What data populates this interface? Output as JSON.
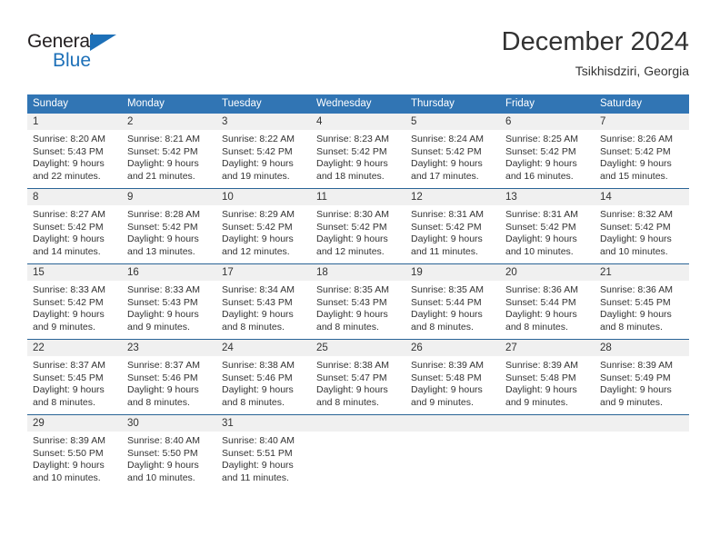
{
  "logo": {
    "word_top": "General",
    "word_bottom": "Blue",
    "triangle_color": "#1d70b8",
    "text_color": "#231f20"
  },
  "header": {
    "title": "December 2024",
    "subtitle": "Tsikhisdziri, Georgia"
  },
  "theme": {
    "header_bg": "#3175b4",
    "row_divider": "#2a6496",
    "daynum_bg": "#f0f0f0",
    "text": "#333333"
  },
  "calendar": {
    "weekday_headers": [
      "Sunday",
      "Monday",
      "Tuesday",
      "Wednesday",
      "Thursday",
      "Friday",
      "Saturday"
    ],
    "weeks": [
      [
        {
          "day": "1",
          "sunrise": "Sunrise: 8:20 AM",
          "sunset": "Sunset: 5:43 PM",
          "daylight1": "Daylight: 9 hours",
          "daylight2": "and 22 minutes."
        },
        {
          "day": "2",
          "sunrise": "Sunrise: 8:21 AM",
          "sunset": "Sunset: 5:42 PM",
          "daylight1": "Daylight: 9 hours",
          "daylight2": "and 21 minutes."
        },
        {
          "day": "3",
          "sunrise": "Sunrise: 8:22 AM",
          "sunset": "Sunset: 5:42 PM",
          "daylight1": "Daylight: 9 hours",
          "daylight2": "and 19 minutes."
        },
        {
          "day": "4",
          "sunrise": "Sunrise: 8:23 AM",
          "sunset": "Sunset: 5:42 PM",
          "daylight1": "Daylight: 9 hours",
          "daylight2": "and 18 minutes."
        },
        {
          "day": "5",
          "sunrise": "Sunrise: 8:24 AM",
          "sunset": "Sunset: 5:42 PM",
          "daylight1": "Daylight: 9 hours",
          "daylight2": "and 17 minutes."
        },
        {
          "day": "6",
          "sunrise": "Sunrise: 8:25 AM",
          "sunset": "Sunset: 5:42 PM",
          "daylight1": "Daylight: 9 hours",
          "daylight2": "and 16 minutes."
        },
        {
          "day": "7",
          "sunrise": "Sunrise: 8:26 AM",
          "sunset": "Sunset: 5:42 PM",
          "daylight1": "Daylight: 9 hours",
          "daylight2": "and 15 minutes."
        }
      ],
      [
        {
          "day": "8",
          "sunrise": "Sunrise: 8:27 AM",
          "sunset": "Sunset: 5:42 PM",
          "daylight1": "Daylight: 9 hours",
          "daylight2": "and 14 minutes."
        },
        {
          "day": "9",
          "sunrise": "Sunrise: 8:28 AM",
          "sunset": "Sunset: 5:42 PM",
          "daylight1": "Daylight: 9 hours",
          "daylight2": "and 13 minutes."
        },
        {
          "day": "10",
          "sunrise": "Sunrise: 8:29 AM",
          "sunset": "Sunset: 5:42 PM",
          "daylight1": "Daylight: 9 hours",
          "daylight2": "and 12 minutes."
        },
        {
          "day": "11",
          "sunrise": "Sunrise: 8:30 AM",
          "sunset": "Sunset: 5:42 PM",
          "daylight1": "Daylight: 9 hours",
          "daylight2": "and 12 minutes."
        },
        {
          "day": "12",
          "sunrise": "Sunrise: 8:31 AM",
          "sunset": "Sunset: 5:42 PM",
          "daylight1": "Daylight: 9 hours",
          "daylight2": "and 11 minutes."
        },
        {
          "day": "13",
          "sunrise": "Sunrise: 8:31 AM",
          "sunset": "Sunset: 5:42 PM",
          "daylight1": "Daylight: 9 hours",
          "daylight2": "and 10 minutes."
        },
        {
          "day": "14",
          "sunrise": "Sunrise: 8:32 AM",
          "sunset": "Sunset: 5:42 PM",
          "daylight1": "Daylight: 9 hours",
          "daylight2": "and 10 minutes."
        }
      ],
      [
        {
          "day": "15",
          "sunrise": "Sunrise: 8:33 AM",
          "sunset": "Sunset: 5:42 PM",
          "daylight1": "Daylight: 9 hours",
          "daylight2": "and 9 minutes."
        },
        {
          "day": "16",
          "sunrise": "Sunrise: 8:33 AM",
          "sunset": "Sunset: 5:43 PM",
          "daylight1": "Daylight: 9 hours",
          "daylight2": "and 9 minutes."
        },
        {
          "day": "17",
          "sunrise": "Sunrise: 8:34 AM",
          "sunset": "Sunset: 5:43 PM",
          "daylight1": "Daylight: 9 hours",
          "daylight2": "and 8 minutes."
        },
        {
          "day": "18",
          "sunrise": "Sunrise: 8:35 AM",
          "sunset": "Sunset: 5:43 PM",
          "daylight1": "Daylight: 9 hours",
          "daylight2": "and 8 minutes."
        },
        {
          "day": "19",
          "sunrise": "Sunrise: 8:35 AM",
          "sunset": "Sunset: 5:44 PM",
          "daylight1": "Daylight: 9 hours",
          "daylight2": "and 8 minutes."
        },
        {
          "day": "20",
          "sunrise": "Sunrise: 8:36 AM",
          "sunset": "Sunset: 5:44 PM",
          "daylight1": "Daylight: 9 hours",
          "daylight2": "and 8 minutes."
        },
        {
          "day": "21",
          "sunrise": "Sunrise: 8:36 AM",
          "sunset": "Sunset: 5:45 PM",
          "daylight1": "Daylight: 9 hours",
          "daylight2": "and 8 minutes."
        }
      ],
      [
        {
          "day": "22",
          "sunrise": "Sunrise: 8:37 AM",
          "sunset": "Sunset: 5:45 PM",
          "daylight1": "Daylight: 9 hours",
          "daylight2": "and 8 minutes."
        },
        {
          "day": "23",
          "sunrise": "Sunrise: 8:37 AM",
          "sunset": "Sunset: 5:46 PM",
          "daylight1": "Daylight: 9 hours",
          "daylight2": "and 8 minutes."
        },
        {
          "day": "24",
          "sunrise": "Sunrise: 8:38 AM",
          "sunset": "Sunset: 5:46 PM",
          "daylight1": "Daylight: 9 hours",
          "daylight2": "and 8 minutes."
        },
        {
          "day": "25",
          "sunrise": "Sunrise: 8:38 AM",
          "sunset": "Sunset: 5:47 PM",
          "daylight1": "Daylight: 9 hours",
          "daylight2": "and 8 minutes."
        },
        {
          "day": "26",
          "sunrise": "Sunrise: 8:39 AM",
          "sunset": "Sunset: 5:48 PM",
          "daylight1": "Daylight: 9 hours",
          "daylight2": "and 9 minutes."
        },
        {
          "day": "27",
          "sunrise": "Sunrise: 8:39 AM",
          "sunset": "Sunset: 5:48 PM",
          "daylight1": "Daylight: 9 hours",
          "daylight2": "and 9 minutes."
        },
        {
          "day": "28",
          "sunrise": "Sunrise: 8:39 AM",
          "sunset": "Sunset: 5:49 PM",
          "daylight1": "Daylight: 9 hours",
          "daylight2": "and 9 minutes."
        }
      ],
      [
        {
          "day": "29",
          "sunrise": "Sunrise: 8:39 AM",
          "sunset": "Sunset: 5:50 PM",
          "daylight1": "Daylight: 9 hours",
          "daylight2": "and 10 minutes."
        },
        {
          "day": "30",
          "sunrise": "Sunrise: 8:40 AM",
          "sunset": "Sunset: 5:50 PM",
          "daylight1": "Daylight: 9 hours",
          "daylight2": "and 10 minutes."
        },
        {
          "day": "31",
          "sunrise": "Sunrise: 8:40 AM",
          "sunset": "Sunset: 5:51 PM",
          "daylight1": "Daylight: 9 hours",
          "daylight2": "and 11 minutes."
        },
        {
          "day": "",
          "sunrise": "",
          "sunset": "",
          "daylight1": "",
          "daylight2": ""
        },
        {
          "day": "",
          "sunrise": "",
          "sunset": "",
          "daylight1": "",
          "daylight2": ""
        },
        {
          "day": "",
          "sunrise": "",
          "sunset": "",
          "daylight1": "",
          "daylight2": ""
        },
        {
          "day": "",
          "sunrise": "",
          "sunset": "",
          "daylight1": "",
          "daylight2": ""
        }
      ]
    ]
  }
}
